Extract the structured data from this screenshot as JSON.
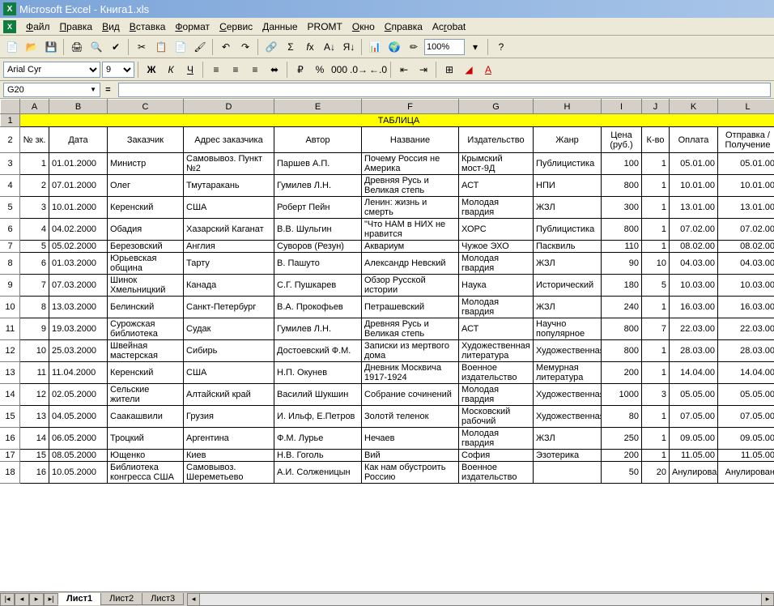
{
  "window": {
    "title": "Microsoft Excel - Книга1.xls"
  },
  "menu": [
    "Файл",
    "Правка",
    "Вид",
    "Вставка",
    "Формат",
    "Сервис",
    "Данные",
    "PROMT",
    "Окно",
    "Справка",
    "Acrobat"
  ],
  "menu_underline": [
    "Ф",
    "П",
    "В",
    "В",
    "Ф",
    "С",
    "Д",
    "",
    "О",
    "С",
    "r"
  ],
  "font": {
    "name": "Arial Cyr",
    "size": "9"
  },
  "zoom": "100%",
  "cell_ref": "G20",
  "columns": [
    "A",
    "B",
    "C",
    "D",
    "E",
    "F",
    "G",
    "H",
    "I",
    "J",
    "K",
    "L"
  ],
  "title_cell": "ТАБЛИЦА",
  "headers": [
    "№ зк.",
    "Дата",
    "Заказчик",
    "Адрес заказчика",
    "Автор",
    "Название",
    "Издательство",
    "Жанр",
    "Цена (руб.)",
    "К-во",
    "Оплата",
    "Отправка / Получение"
  ],
  "rows": [
    {
      "n": "1",
      "date": "01.01.2000",
      "cust": "Министр",
      "addr": "Самовывоз. Пункт №2",
      "author": "Паршев А.П.",
      "title": "Почему Россия не Америка",
      "pub": "Крымский мост-9Д",
      "genre": "Публицистика",
      "price": "100",
      "qty": "1",
      "pay": "05.01.00",
      "ship": "05.01.00"
    },
    {
      "n": "2",
      "date": "07.01.2000",
      "cust": "Олег",
      "addr": "Тмутаракань",
      "author": "Гумилев Л.Н.",
      "title": "Древняя Русь и Великая степь",
      "pub": "АСТ",
      "genre": "НПИ",
      "price": "800",
      "qty": "1",
      "pay": "10.01.00",
      "ship": "10.01.00"
    },
    {
      "n": "3",
      "date": "10.01.2000",
      "cust": "Керенский",
      "addr": "США",
      "author": "Роберт Пейн",
      "title": "Ленин: жизнь и смерть",
      "pub": "Молодая гвардия",
      "genre": "ЖЗЛ",
      "price": "300",
      "qty": "1",
      "pay": "13.01.00",
      "ship": "13.01.00"
    },
    {
      "n": "4",
      "date": "04.02.2000",
      "cust": "Обадия",
      "addr": "Хазарский Каганат",
      "author": "В.В. Шульгин",
      "title": "\"Что НАМ в НИХ не нравится",
      "pub": "ХОРС",
      "genre": "Публицистика",
      "price": "800",
      "qty": "1",
      "pay": "07.02.00",
      "ship": "07.02.00"
    },
    {
      "n": "5",
      "date": "05.02.2000",
      "cust": "Березовский",
      "addr": "Англия",
      "author": "Суворов (Резун)",
      "title": "Аквариум",
      "pub": "Чужое ЭХО",
      "genre": "Пасквиль",
      "price": "110",
      "qty": "1",
      "pay": "08.02.00",
      "ship": "08.02.00"
    },
    {
      "n": "6",
      "date": "01.03.2000",
      "cust": "Юрьевская община",
      "addr": "Тарту",
      "author": "В. Пашуто",
      "title": "Александр Невский",
      "pub": "Молодая гвардия",
      "genre": "ЖЗЛ",
      "price": "90",
      "qty": "10",
      "pay": "04.03.00",
      "ship": "04.03.00"
    },
    {
      "n": "7",
      "date": "07.03.2000",
      "cust": "Шинок Хмельницкий",
      "addr": "Канада",
      "author": "С.Г. Пушкарев",
      "title": "Обзор Русской истории",
      "pub": "Наука",
      "genre": "Исторический",
      "price": "180",
      "qty": "5",
      "pay": "10.03.00",
      "ship": "10.03.00"
    },
    {
      "n": "8",
      "date": "13.03.2000",
      "cust": "Белинский",
      "addr": "Санкт-Петербург",
      "author": "В.А. Прокофьев",
      "title": "Петрашевский",
      "pub": "Молодая гвардия",
      "genre": "ЖЗЛ",
      "price": "240",
      "qty": "1",
      "pay": "16.03.00",
      "ship": "16.03.00"
    },
    {
      "n": "9",
      "date": "19.03.2000",
      "cust": "Сурожская библиотека",
      "addr": "Судак",
      "author": "Гумилев Л.Н.",
      "title": "Древняя Русь и Великая степь",
      "pub": "АСТ",
      "genre": "Научно популярное",
      "price": "800",
      "qty": "7",
      "pay": "22.03.00",
      "ship": "22.03.00"
    },
    {
      "n": "10",
      "date": "25.03.2000",
      "cust": "Швейная мастерская",
      "addr": "Сибирь",
      "author": "Достоевский Ф.М.",
      "title": "Записки из мертвого дома",
      "pub": "Художественная литература",
      "genre": "Художественная",
      "price": "800",
      "qty": "1",
      "pay": "28.03.00",
      "ship": "28.03.00"
    },
    {
      "n": "11",
      "date": "11.04.2000",
      "cust": "Керенский",
      "addr": "США",
      "author": "Н.П. Окунев",
      "title": "Дневник Москвича 1917-1924",
      "pub": "Военное издательство",
      "genre": "Мемурная литература",
      "price": "200",
      "qty": "1",
      "pay": "14.04.00",
      "ship": "14.04.00"
    },
    {
      "n": "12",
      "date": "02.05.2000",
      "cust": "Сельские жители",
      "addr": "Алтайский край",
      "author": "Василий Шукшин",
      "title": "Собрание сочинений",
      "pub": "Молодая гвардия",
      "genre": "Художественная",
      "price": "1000",
      "qty": "3",
      "pay": "05.05.00",
      "ship": "05.05.00"
    },
    {
      "n": "13",
      "date": "04.05.2000",
      "cust": "Саакашвили",
      "addr": "Грузия",
      "author": "И. Ильф, Е.Петров",
      "title": "Золотй теленок",
      "pub": "Московский рабочий",
      "genre": "Художественная",
      "price": "80",
      "qty": "1",
      "pay": "07.05.00",
      "ship": "07.05.00"
    },
    {
      "n": "14",
      "date": "06.05.2000",
      "cust": "Троцкий",
      "addr": "Аргентина",
      "author": "Ф.М. Лурье",
      "title": "Нечаев",
      "pub": "Молодая гвардия",
      "genre": "ЖЗЛ",
      "price": "250",
      "qty": "1",
      "pay": "09.05.00",
      "ship": "09.05.00"
    },
    {
      "n": "15",
      "date": "08.05.2000",
      "cust": "Ющенко",
      "addr": "Киев",
      "author": "Н.В. Гоголь",
      "title": "Вий",
      "pub": "София",
      "genre": "Эзотерика",
      "price": "200",
      "qty": "1",
      "pay": "11.05.00",
      "ship": "11.05.00"
    },
    {
      "n": "16",
      "date": "10.05.2000",
      "cust": "Библиотека конгресса США",
      "addr": "Самовывоз. Шереметьево",
      "author": "А.И. Солженицын",
      "title": "Как нам обустроить Россию",
      "pub": "Военное издательство",
      "genre": "",
      "price": "50",
      "qty": "20",
      "pay": "Анулирован",
      "ship": "Анулирован"
    }
  ],
  "sheets": [
    "Лист1",
    "Лист2",
    "Лист3"
  ],
  "active_sheet": 0
}
